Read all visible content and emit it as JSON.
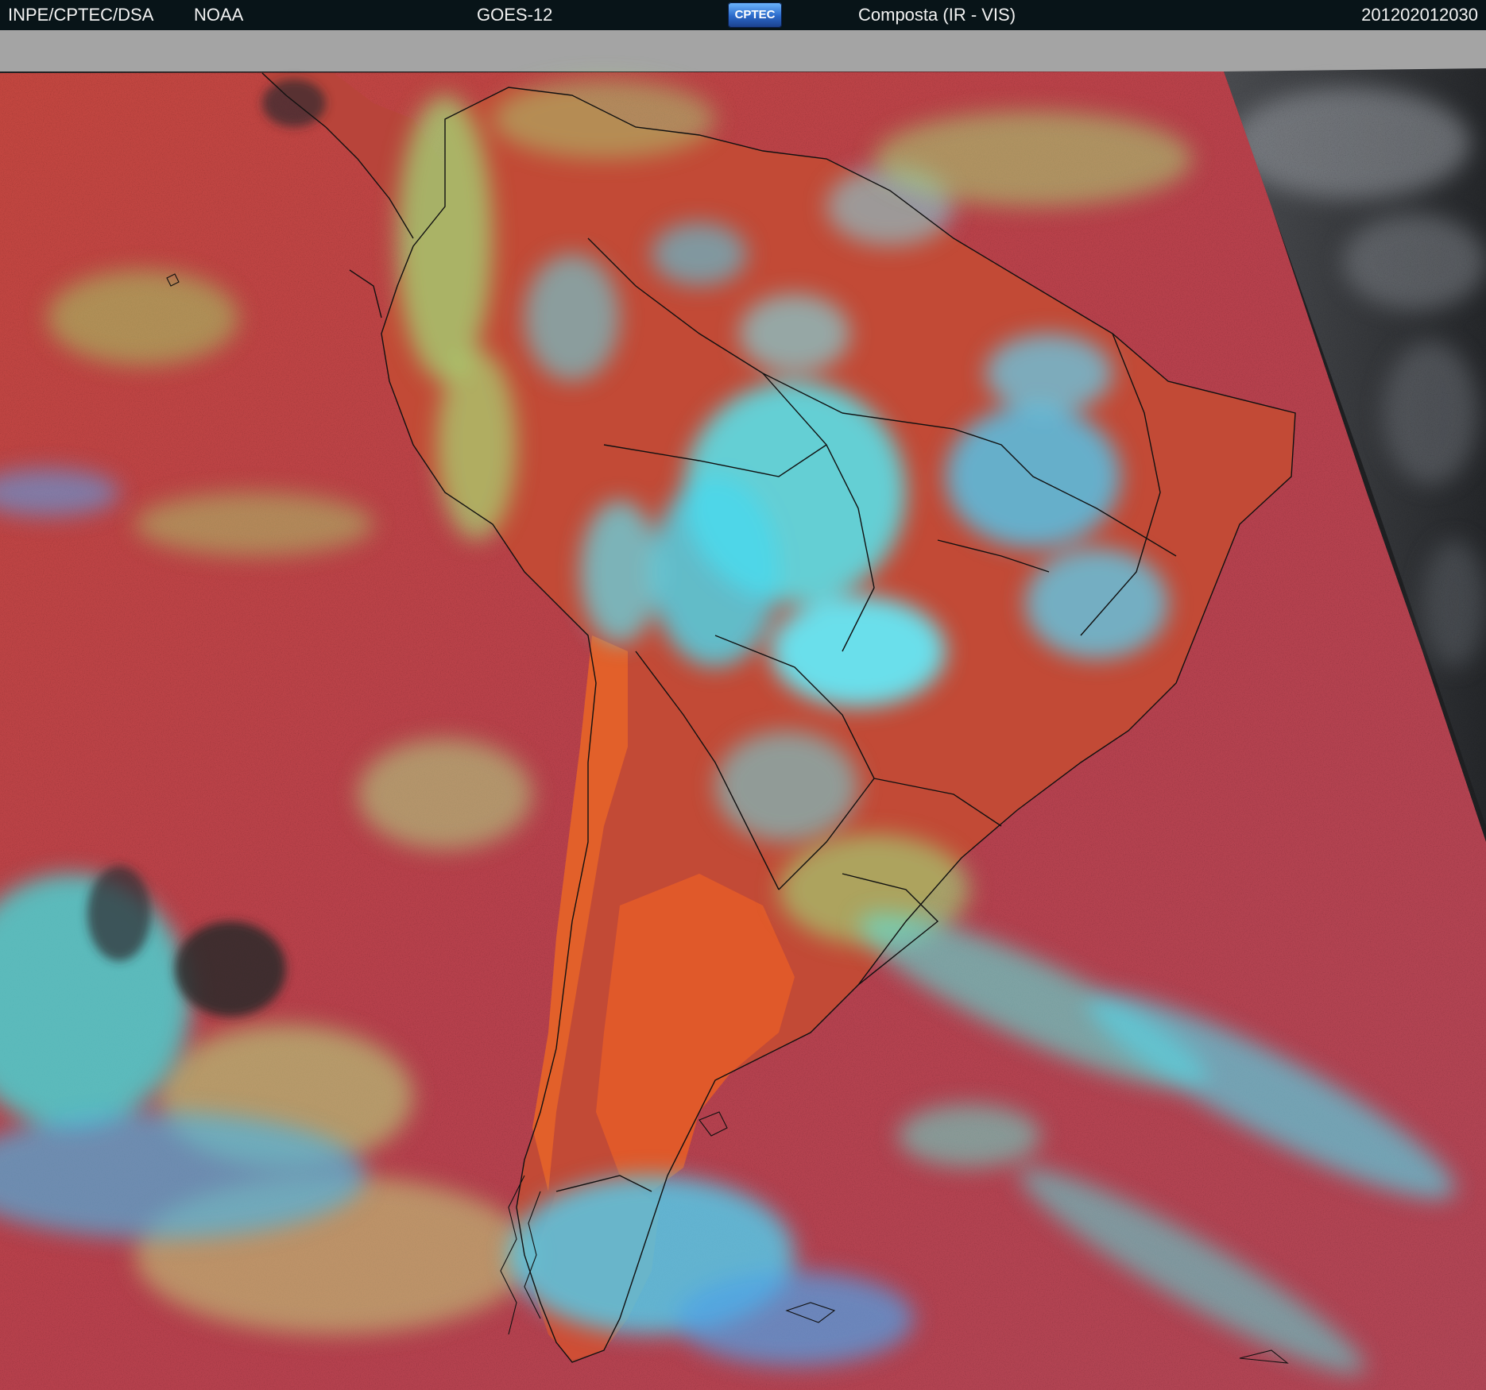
{
  "header": {
    "agency": "INPE/CPTEC/DSA",
    "source": "NOAA",
    "satellite": "GOES-12",
    "logo_text": "CPTEC",
    "product": "Composta (IR - VIS)",
    "timestamp": "201202012030"
  },
  "image": {
    "kind": "satellite composite",
    "region": "South America",
    "colors": {
      "warm_ocean": "#b8424a",
      "land_orange": "#d9572a",
      "cloud_cyan": "#54e6f0",
      "cloud_green": "#9fe07a",
      "cloud_blue": "#4b8fe0",
      "clear_sky": "#2a2a2a",
      "vis_panel": "#3a3c40",
      "no_data": "#a4a4a4",
      "borders": "#101010"
    }
  }
}
